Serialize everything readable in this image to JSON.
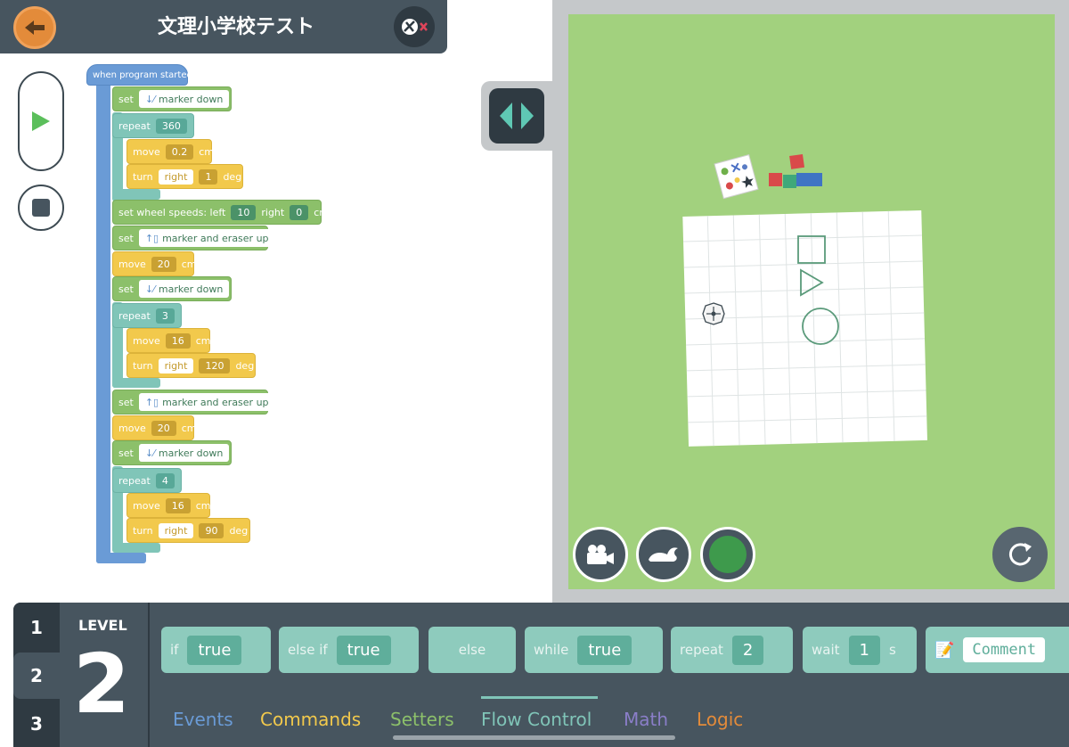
{
  "header": {
    "title": "文理小学校テスト"
  },
  "program": {
    "event_label": "when program started",
    "blocks": {
      "set1": {
        "kw": "set",
        "value": "marker down"
      },
      "repeat1": {
        "kw": "repeat",
        "count": "360"
      },
      "move1": {
        "kw": "move",
        "value": "0.2",
        "unit": "cm"
      },
      "turn1": {
        "kw": "turn",
        "dir": "right",
        "value": "1",
        "unit": "deg"
      },
      "wheels": {
        "label": "set wheel speeds: left",
        "left": "10",
        "right_label": "right",
        "right": "0",
        "unit": "cm/s"
      },
      "set2": {
        "kw": "set",
        "value": "marker and eraser up"
      },
      "move2": {
        "kw": "move",
        "value": "20",
        "unit": "cm"
      },
      "set3": {
        "kw": "set",
        "value": "marker down"
      },
      "repeat2": {
        "kw": "repeat",
        "count": "3"
      },
      "move3": {
        "kw": "move",
        "value": "16",
        "unit": "cm"
      },
      "turn2": {
        "kw": "turn",
        "dir": "right",
        "value": "120",
        "unit": "deg"
      },
      "set4": {
        "kw": "set",
        "value": "marker and eraser up"
      },
      "move4": {
        "kw": "move",
        "value": "20",
        "unit": "cm"
      },
      "set5": {
        "kw": "set",
        "value": "marker down"
      },
      "repeat3": {
        "kw": "repeat",
        "count": "4"
      },
      "move5": {
        "kw": "move",
        "value": "16",
        "unit": "cm"
      },
      "turn3": {
        "kw": "turn",
        "dir": "right",
        "value": "90",
        "unit": "deg"
      }
    }
  },
  "palette": {
    "levels": [
      "1",
      "2",
      "3"
    ],
    "level_label": "LEVEL",
    "level_current": "2",
    "blocks": {
      "if": {
        "kw": "if",
        "val": "true"
      },
      "elseif": {
        "kw": "else if",
        "val": "true"
      },
      "else": {
        "kw": "else"
      },
      "while": {
        "kw": "while",
        "val": "true"
      },
      "repeat": {
        "kw": "repeat",
        "val": "2"
      },
      "wait": {
        "kw": "wait",
        "val": "1",
        "unit": "s"
      },
      "comment": {
        "val": "Comment"
      }
    },
    "categories": {
      "events": "Events",
      "commands": "Commands",
      "setters": "Setters",
      "flow": "Flow Control",
      "math": "Math",
      "logic": "Logic"
    }
  },
  "colors": {
    "accent_orange": "#e38b3a",
    "dark": "#47555f",
    "sim_green": "#a2d17e",
    "teal": "#80c5b8"
  }
}
